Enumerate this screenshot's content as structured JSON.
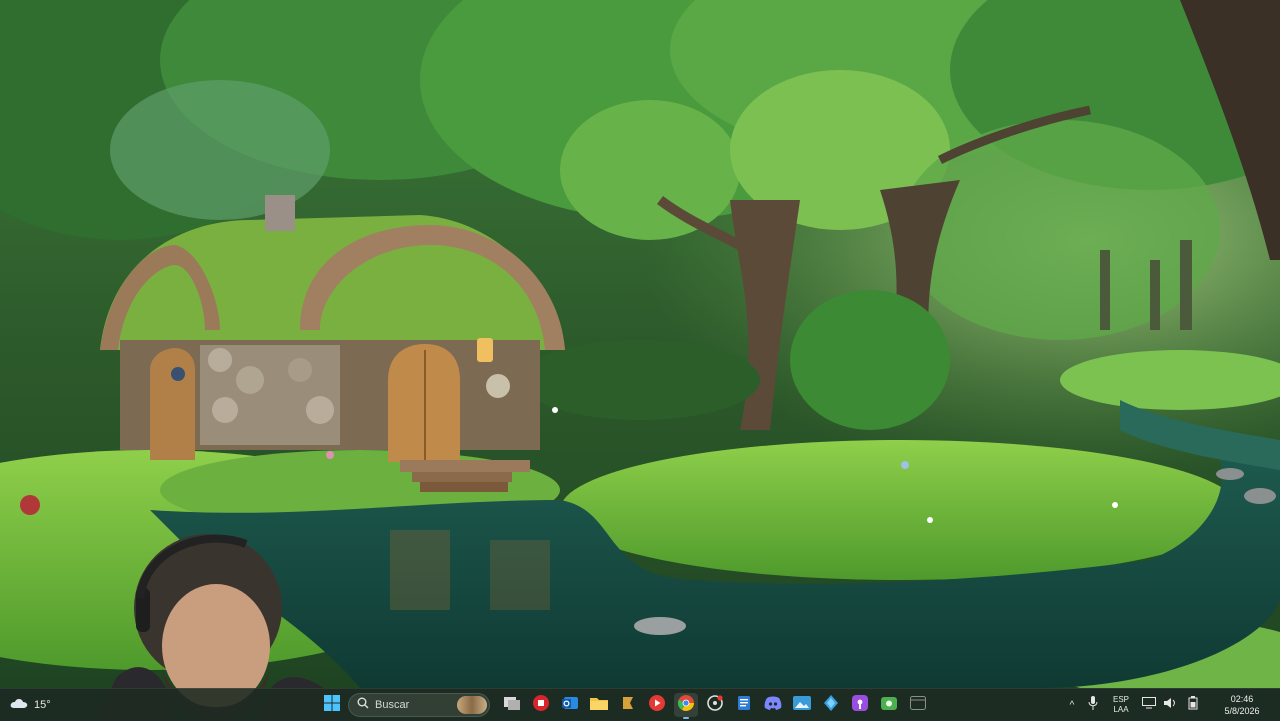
{
  "taskbar": {
    "weather": {
      "temp": "15°",
      "icon": "cloud-icon"
    },
    "start_icon": "windows-logo-icon",
    "search": {
      "placeholder": "Buscar",
      "icon": "search-icon"
    },
    "apps": [
      {
        "name": "task-view",
        "icon": "task-view-icon",
        "color": "#d0d0d0"
      },
      {
        "name": "antivirus",
        "icon": "shield-icon",
        "color": "#d8252c"
      },
      {
        "name": "outlook",
        "icon": "mail-icon",
        "color": "#1a73c8"
      },
      {
        "name": "file-explorer",
        "icon": "folder-icon",
        "color": "#f0c040"
      },
      {
        "name": "app-tool",
        "icon": "tool-icon",
        "color": "#d7a13a"
      },
      {
        "name": "media-player",
        "icon": "play-icon",
        "color": "#e53935"
      },
      {
        "name": "chrome",
        "icon": "chrome-icon",
        "color": "#4285f4"
      },
      {
        "name": "app-recorder",
        "icon": "record-icon",
        "color": "#e0e0e0"
      },
      {
        "name": "notepad",
        "icon": "notepad-icon",
        "color": "#2b7dd6"
      },
      {
        "name": "discord",
        "icon": "discord-icon",
        "color": "#5865f2"
      },
      {
        "name": "photos",
        "icon": "photo-icon",
        "color": "#3a9bd9"
      },
      {
        "name": "app-diamond",
        "icon": "diamond-icon",
        "color": "#3aa0e0"
      },
      {
        "name": "podcasts",
        "icon": "podcast-icon",
        "color": "#9b4de0"
      },
      {
        "name": "app-green",
        "icon": "camera-icon",
        "color": "#4caf50"
      },
      {
        "name": "app-dim",
        "icon": "window-icon",
        "color": "#8a8f8a"
      }
    ],
    "tray": {
      "chevron": "^",
      "lang_line1": "ESP",
      "lang_line2": "LAA",
      "time": "02:46",
      "date": "5/8/2026"
    }
  },
  "colors": {
    "accent": "#7fb6e8",
    "taskbar": "#1e2a22"
  }
}
